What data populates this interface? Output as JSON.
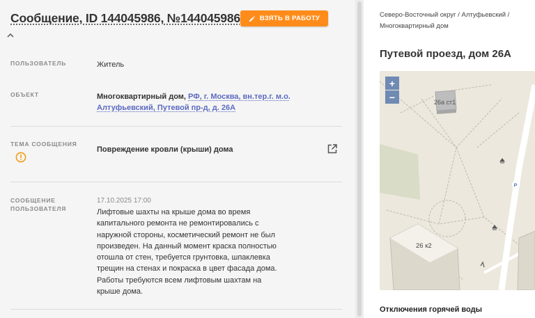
{
  "header": {
    "title": "Сообщение, ID 144045986, №144045986",
    "take_button": "ВЗЯТЬ В РАБОТУ"
  },
  "details": {
    "user_label": "ПОЛЬЗОВАТЕЛЬ",
    "user_value": "Житель",
    "object_label": "ОБЪЕКТ",
    "object_type": "Многоквартирный дом,",
    "object_link": "РФ, г. Москва, вн.тер.г. м.о. Алтуфьевский, Путевой пр-д, д. 26А",
    "topic_label": "ТЕМА СООБЩЕНИЯ",
    "topic_value": "Повреждение кровли (крыши) дома",
    "message_label": "СООБЩЕНИЕ ПОЛЬЗОВАТЕЛЯ",
    "message_date": "17.10.2025 17:00",
    "message_text": "Лифтовые шахты на крыше дома во время капитального ремонта не ремонтировались с наружной стороны, косметический ремонт не был произведен. На данный момент краска полностью отошла от стен, требуется грунтовка, шпаклевка трещин на стенах и покраска в цвет фасада дома. Работы требуются всем лифтовым шахтам на крыше дома."
  },
  "right_panel": {
    "breadcrumbs": "Северо-Восточный округ / Алтуфьевский / Многоквартирный дом",
    "address": "Путевой проезд, дом 26А",
    "map": {
      "zoom_in": "+",
      "zoom_out": "−",
      "building_label_1": "26а ст1",
      "building_label_2": "26 к2",
      "parking_label": "P"
    },
    "section_title": "Отключения горячей воды"
  },
  "colors": {
    "accent_orange": "#ff8c1a",
    "link_blue": "#5c6bc0",
    "warning_orange": "#f39c12"
  }
}
